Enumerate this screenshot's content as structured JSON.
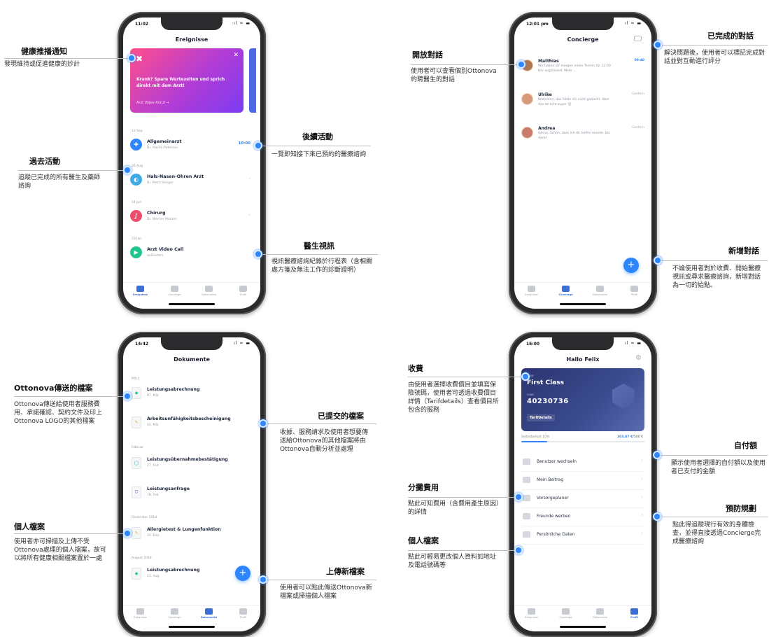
{
  "panel1": {
    "status_time": "11:02",
    "status_icons": "ᐧıl ≈ ▬",
    "screen_title": "Ereignisse",
    "promo": {
      "icon": "✖",
      "close": "✕",
      "text": "Krank? Spare Wartezeiten und sprich direkt mit dem Arzt!",
      "link": "Arzt Video Anruf →"
    },
    "events": [
      {
        "date": "13 Sep",
        "title": "Allgemeinarzt",
        "subtitle": "Dr. Martin Peterson",
        "time": "10:00",
        "color": "#2e86ff",
        "glyph": "✚"
      },
      {
        "date": "26 Aug",
        "title": "Hals-Nasen-Ohren Arzt",
        "subtitle": "Dr. Petra Steiger",
        "time": "",
        "color": "#3fa9e6",
        "glyph": "◐"
      },
      {
        "date": "14 Jun",
        "title": "Chirurg",
        "subtitle": "Dr. Werner Mückel",
        "time": "",
        "color": "#ef4d6b",
        "glyph": "∫"
      },
      {
        "date": "23 Jan",
        "title": "Arzt Video Call",
        "subtitle": "eeDoctors",
        "time": "",
        "color": "#22c58b",
        "glyph": "▶"
      }
    ],
    "tabs": [
      "Ereignisse",
      "Concierge",
      "Dokumente",
      "Profil"
    ],
    "notes": {
      "push": {
        "title": "健康推播通知",
        "text": "發現維持或促進健康的妙計"
      },
      "past": {
        "title": "過去活動",
        "text": "追蹤已完成的所有醫生及藥師諮詢"
      },
      "follow": {
        "title": "後續活動",
        "text": "一覽即知接下來已預約的醫療諮詢"
      },
      "video": {
        "title": "醫生視訊",
        "text": "視訊醫療諮詢紀錄於行程表（含相關處方箋及無法工作的診斷證明）"
      }
    }
  },
  "panel2": {
    "status_time": "12:01 pm",
    "status_icons": "ıl ≈ ▬",
    "screen_title": "Concierge",
    "chats": [
      {
        "name": "Matthias",
        "msg": "Wir haben dir morgen einen Termin für 12:00 Uhr organisiert. Mehr ...",
        "time": "09:40",
        "avatar": "#b0764f"
      },
      {
        "name": "Ulrike",
        "msg": "Wahnsinn, das hätte ich nicht gedacht. Aber das ist echt super 😊",
        "time": "Gestern",
        "avatar": "#d79a7b"
      },
      {
        "name": "Andrea",
        "msg": "Gerne. Schön, dass ich dir helfen konnte. bis dann!",
        "time": "Gestern",
        "avatar": "#c97c6a"
      }
    ],
    "fab": "+",
    "tabs": [
      "Ereignisse",
      "Concierge",
      "Dokumente",
      "Profil"
    ],
    "notes": {
      "open": {
        "title": "開放對話",
        "text": "使用者可以查看個別Ottonova約聘醫生的對話"
      },
      "done": {
        "title": "已完成的對話",
        "text": "解決問題後，使用者可以標記完成對話並對互動進行評分"
      },
      "new": {
        "title": "新增對話",
        "text": "不論使用者對於收費、開始醫療視訊或尋求醫療諮詢，新增對話為一切的始點。"
      }
    }
  },
  "panel3": {
    "status_time": "14:42",
    "status_icons": "ıl ≈ ▬",
    "screen_title": "Dokumente",
    "months": [
      "März",
      "Februar",
      "Dezember 2018",
      "August 2018"
    ],
    "docs": [
      {
        "title": "Leistungsabrechnung",
        "date": "07. Mär",
        "icon": "◆",
        "color": "#22c58b"
      },
      {
        "title": "Arbeitsunfähigkeitsbescheinigung",
        "date": "04. Mär",
        "icon": "✎",
        "color": "#f4b400"
      },
      {
        "title": "Leistungsübernahmebestätigung",
        "date": "27. Feb",
        "icon": "◯",
        "color": "#22b3c5"
      },
      {
        "title": "Leistungsanfrage",
        "date": "18. Feb",
        "icon": "⛉",
        "color": "#5b4fd6"
      },
      {
        "title": "Allergietest & Lungenfunktion",
        "date": "20. Dez",
        "icon": "✎",
        "color": "#f4b400"
      },
      {
        "title": "Leistungsabrechnung",
        "date": "23. Aug",
        "icon": "◆",
        "color": "#22c58b"
      }
    ],
    "fab": "+",
    "tabs": [
      "Ereignisse",
      "Concierge",
      "Dokumente",
      "Profil"
    ],
    "notes": {
      "sent": {
        "title": "Ottonova傳送的檔案",
        "text": "Ottonova傳送給使用者服務費用、承諾確認、契約文件及印上Ottonova LOGO的其他檔案"
      },
      "personal": {
        "title": "個人檔案",
        "text": "使用者亦可掃描及上傳不受Ottonova處理的個人檔案，故可以將所有健康相關檔案置於一處"
      },
      "submitted": {
        "title": "已提交的檔案",
        "text": "收據、服務請求及使用者想要傳送給Ottonova的其他檔案將由Ottonova自動分析並處理"
      },
      "upload": {
        "title": "上傳新檔案",
        "text": "使用者可以點此傳送Ottonova新檔案或掃描個人檔案"
      }
    }
  },
  "panel4": {
    "status_time": "15:00",
    "status_icons": "ıl ≈ ▬",
    "screen_title": "Hallo Felix",
    "gear": "⚙",
    "card": {
      "tarif_label": "TARIF",
      "plan": "First Class",
      "vsnr_label": "VSNR",
      "number": "40230736",
      "details": "Tarifdetails"
    },
    "deductible": {
      "label": "Selbstbehalt 10%",
      "used": "103,87 €",
      "total": "/500 €",
      "progress": 0.21
    },
    "menu": [
      "Benutzer wechseln",
      "Mein Beitrag",
      "Vorsorgeplaner",
      "Freunde werben",
      "Persönliche Daten"
    ],
    "tabs": [
      "Ereignisse",
      "Concierge",
      "Dokumente",
      "Profil"
    ],
    "notes": {
      "fee": {
        "title": "收費",
        "text": "由使用者選擇收費價目並填寫保險號碼，使用者可透過收費價目詳情（Tarifdetails）查看價目所包含的服務"
      },
      "share": {
        "title": "分攤費用",
        "text": "點此可知費用（含費用產生原因）的詳情"
      },
      "profile": {
        "title": "個人檔案",
        "text": "點此可輕易更改個人資料如地址及電話號碼等"
      },
      "self": {
        "title": "自付額",
        "text": "顯示使用者選擇的自付額以及使用者已支付的金額"
      },
      "prevent": {
        "title": "預防規劃",
        "text": "點此得追蹤現行有效的身體檢查，並得直接透過Concierge完成醫療諮詢"
      }
    }
  }
}
